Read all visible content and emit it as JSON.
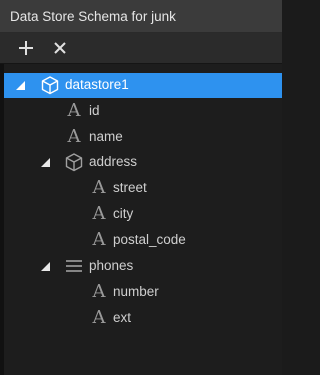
{
  "window": {
    "title": "Data Store Schema for junk"
  },
  "toolbar": {
    "add_icon": "plus-icon",
    "remove_icon": "close-icon"
  },
  "tree": {
    "root": {
      "label": "datastore1",
      "icon": "cube-icon",
      "expanded": true,
      "selected": true
    },
    "id": {
      "label": "id",
      "icon": "text-field-icon"
    },
    "name": {
      "label": "name",
      "icon": "text-field-icon"
    },
    "address": {
      "label": "address",
      "icon": "cube-icon",
      "expanded": true,
      "street": {
        "label": "street",
        "icon": "text-field-icon"
      },
      "city": {
        "label": "city",
        "icon": "text-field-icon"
      },
      "postal_code": {
        "label": "postal_code",
        "icon": "text-field-icon"
      }
    },
    "phones": {
      "label": "phones",
      "icon": "list-icon",
      "expanded": true,
      "number": {
        "label": "number",
        "icon": "text-field-icon"
      },
      "ext": {
        "label": "ext",
        "icon": "text-field-icon"
      }
    },
    "text_icon_glyph": "A"
  },
  "colors": {
    "selection": "#2e92ef",
    "titlebar": "#3b3b3b",
    "toolbar": "#2b2b2b",
    "background": "#1d1d1d"
  }
}
